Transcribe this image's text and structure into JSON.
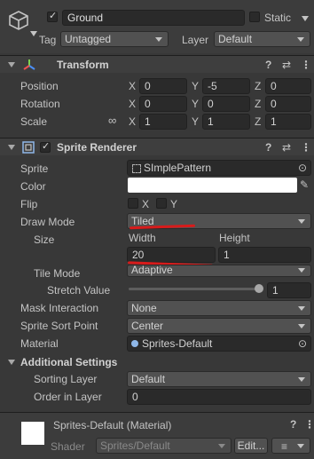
{
  "object": {
    "active": true,
    "name": "Ground",
    "static_label": "Static",
    "tag_label": "Tag",
    "tag_value": "Untagged",
    "layer_label": "Layer",
    "layer_value": "Default"
  },
  "transform": {
    "title": "Transform",
    "rows": [
      {
        "label": "Position",
        "x": "0",
        "y": "-5",
        "z": "0"
      },
      {
        "label": "Rotation",
        "x": "0",
        "y": "0",
        "z": "0"
      },
      {
        "label": "Scale",
        "x": "1",
        "y": "1",
        "z": "1"
      }
    ],
    "axis": {
      "x": "X",
      "y": "Y",
      "z": "Z"
    }
  },
  "sprite_renderer": {
    "title": "Sprite Renderer",
    "enabled": true,
    "sprite_label": "Sprite",
    "sprite_value": "SImplePattern",
    "color_label": "Color",
    "color_value": "#ffffff",
    "flip_label": "Flip",
    "flip_x": "X",
    "flip_y": "Y",
    "draw_mode_label": "Draw Mode",
    "draw_mode_value": "Tiled",
    "size_label": "Size",
    "width_label": "Width",
    "height_label": "Height",
    "width_value": "20",
    "height_value": "1",
    "tile_mode_label": "Tile Mode",
    "tile_mode_value": "Adaptive",
    "stretch_label": "Stretch Value",
    "stretch_value": "1",
    "mask_label": "Mask Interaction",
    "mask_value": "None",
    "sort_point_label": "Sprite Sort Point",
    "sort_point_value": "Center",
    "material_label": "Material",
    "material_value": "Sprites-Default",
    "additional_label": "Additional Settings",
    "sorting_layer_label": "Sorting Layer",
    "sorting_layer_value": "Default",
    "order_label": "Order in Layer",
    "order_value": "0"
  },
  "material_panel": {
    "title": "Sprites-Default (Material)",
    "shader_label": "Shader",
    "shader_value": "Sprites/Default",
    "edit_label": "Edit..."
  },
  "icons": {
    "help": "?",
    "presets": "⇄",
    "menu": "⋮",
    "target": "⊙",
    "eyedropper": "✎",
    "link": "∞"
  },
  "annotation_color": "#d81b1b"
}
